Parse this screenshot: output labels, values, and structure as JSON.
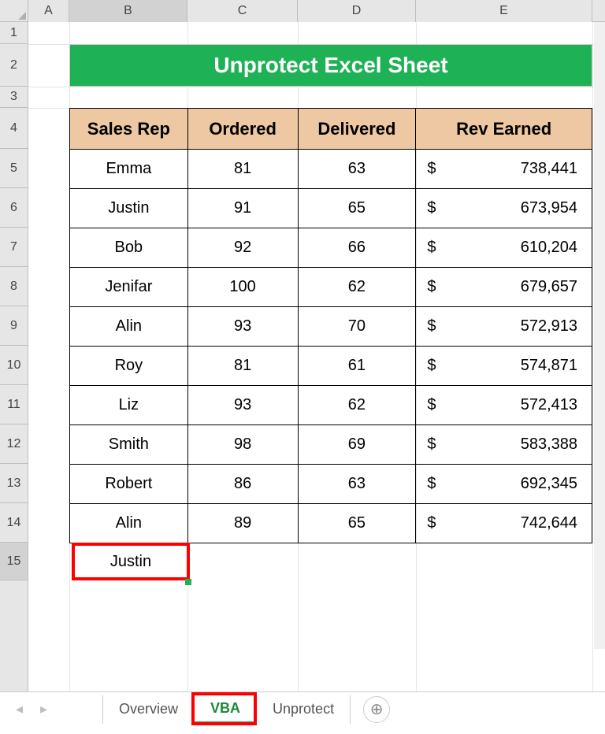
{
  "columns": {
    "A": "A",
    "B": "B",
    "C": "C",
    "D": "D",
    "E": "E"
  },
  "rows": [
    "1",
    "2",
    "3",
    "4",
    "5",
    "6",
    "7",
    "8",
    "9",
    "10",
    "11",
    "12",
    "13",
    "14",
    "15"
  ],
  "title": "Unprotect Excel Sheet",
  "headers": {
    "rep": "Sales Rep",
    "ordered": "Ordered",
    "delivered": "Delivered",
    "rev": "Rev Earned"
  },
  "currency": "$",
  "data": [
    {
      "rep": "Emma",
      "ordered": "81",
      "delivered": "63",
      "rev": "738,441"
    },
    {
      "rep": "Justin",
      "ordered": "91",
      "delivered": "65",
      "rev": "673,954"
    },
    {
      "rep": "Bob",
      "ordered": "92",
      "delivered": "66",
      "rev": "610,204"
    },
    {
      "rep": "Jenifar",
      "ordered": "100",
      "delivered": "62",
      "rev": "679,657"
    },
    {
      "rep": "Alin",
      "ordered": "93",
      "delivered": "70",
      "rev": "572,913"
    },
    {
      "rep": "Roy",
      "ordered": "81",
      "delivered": "61",
      "rev": "574,871"
    },
    {
      "rep": "Liz",
      "ordered": "93",
      "delivered": "62",
      "rev": "572,413"
    },
    {
      "rep": "Smith",
      "ordered": "98",
      "delivered": "69",
      "rev": "583,388"
    },
    {
      "rep": "Robert",
      "ordered": "86",
      "delivered": "63",
      "rev": "692,345"
    },
    {
      "rep": "Alin",
      "ordered": "89",
      "delivered": "65",
      "rev": "742,644"
    }
  ],
  "extra_cell": "Justin",
  "tabs": {
    "overview": "Overview",
    "vba": "VBA",
    "unprotect": "Unprotect"
  },
  "new_sheet_glyph": "⊕",
  "nav": {
    "prev": "◂",
    "next": "▸"
  }
}
